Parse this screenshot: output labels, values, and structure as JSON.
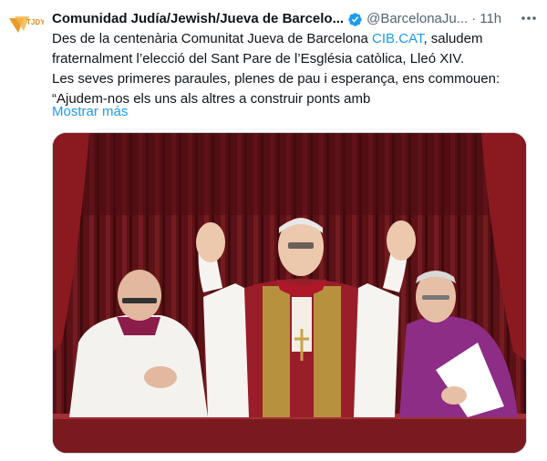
{
  "tweet": {
    "display_name": "Comunidad Judía/Jewish/Jueva de Barcelo...",
    "handle": "@BarcelonaJu...",
    "separator": "·",
    "time": "11h",
    "more_icon": "more-horizontal-icon",
    "verified_icon": "verified-badge-icon",
    "line1_pre": "Des de la centenària Comunitat Jueva de Barcelona ",
    "line1_link": "CIB.CAT",
    "line1_post": ", saludem",
    "line2": "fraternalment l’elecció del Sant Pare de l’Església catòlica, Lleó XIV.",
    "line3": "Les seves primeres paraules, plenes de pau i esperança, ens commouen:",
    "line4": "“Ajudem-nos els uns als altres a construir ponts amb",
    "show_more": "Mostrar más",
    "avatar_text": "TJDY",
    "link_color": "#1d9bf0"
  }
}
